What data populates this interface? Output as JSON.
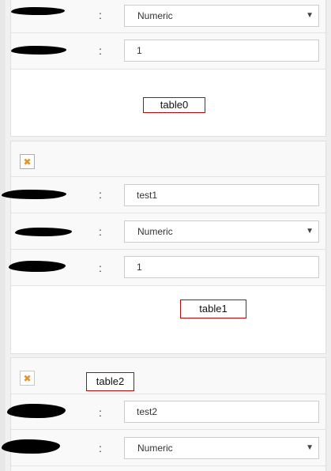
{
  "colon": ":",
  "caret": "▼",
  "table0": {
    "type_select": {
      "value": "Numeric"
    },
    "count_input": {
      "value": "1"
    },
    "label": "table0"
  },
  "table1": {
    "name_input": {
      "value": "test1"
    },
    "type_select": {
      "value": "Numeric"
    },
    "count_input": {
      "value": "1"
    },
    "label": "table1",
    "remove_icon": "close-x-icon"
  },
  "table2": {
    "label": "table2",
    "name_input": {
      "value": "test2"
    },
    "type_select": {
      "value": "Numeric"
    },
    "remove_icon": "close-x-icon"
  },
  "colors": {
    "accent_orange": "#e89421",
    "annotation_red": "#cc0000",
    "border": "#cccccc"
  }
}
